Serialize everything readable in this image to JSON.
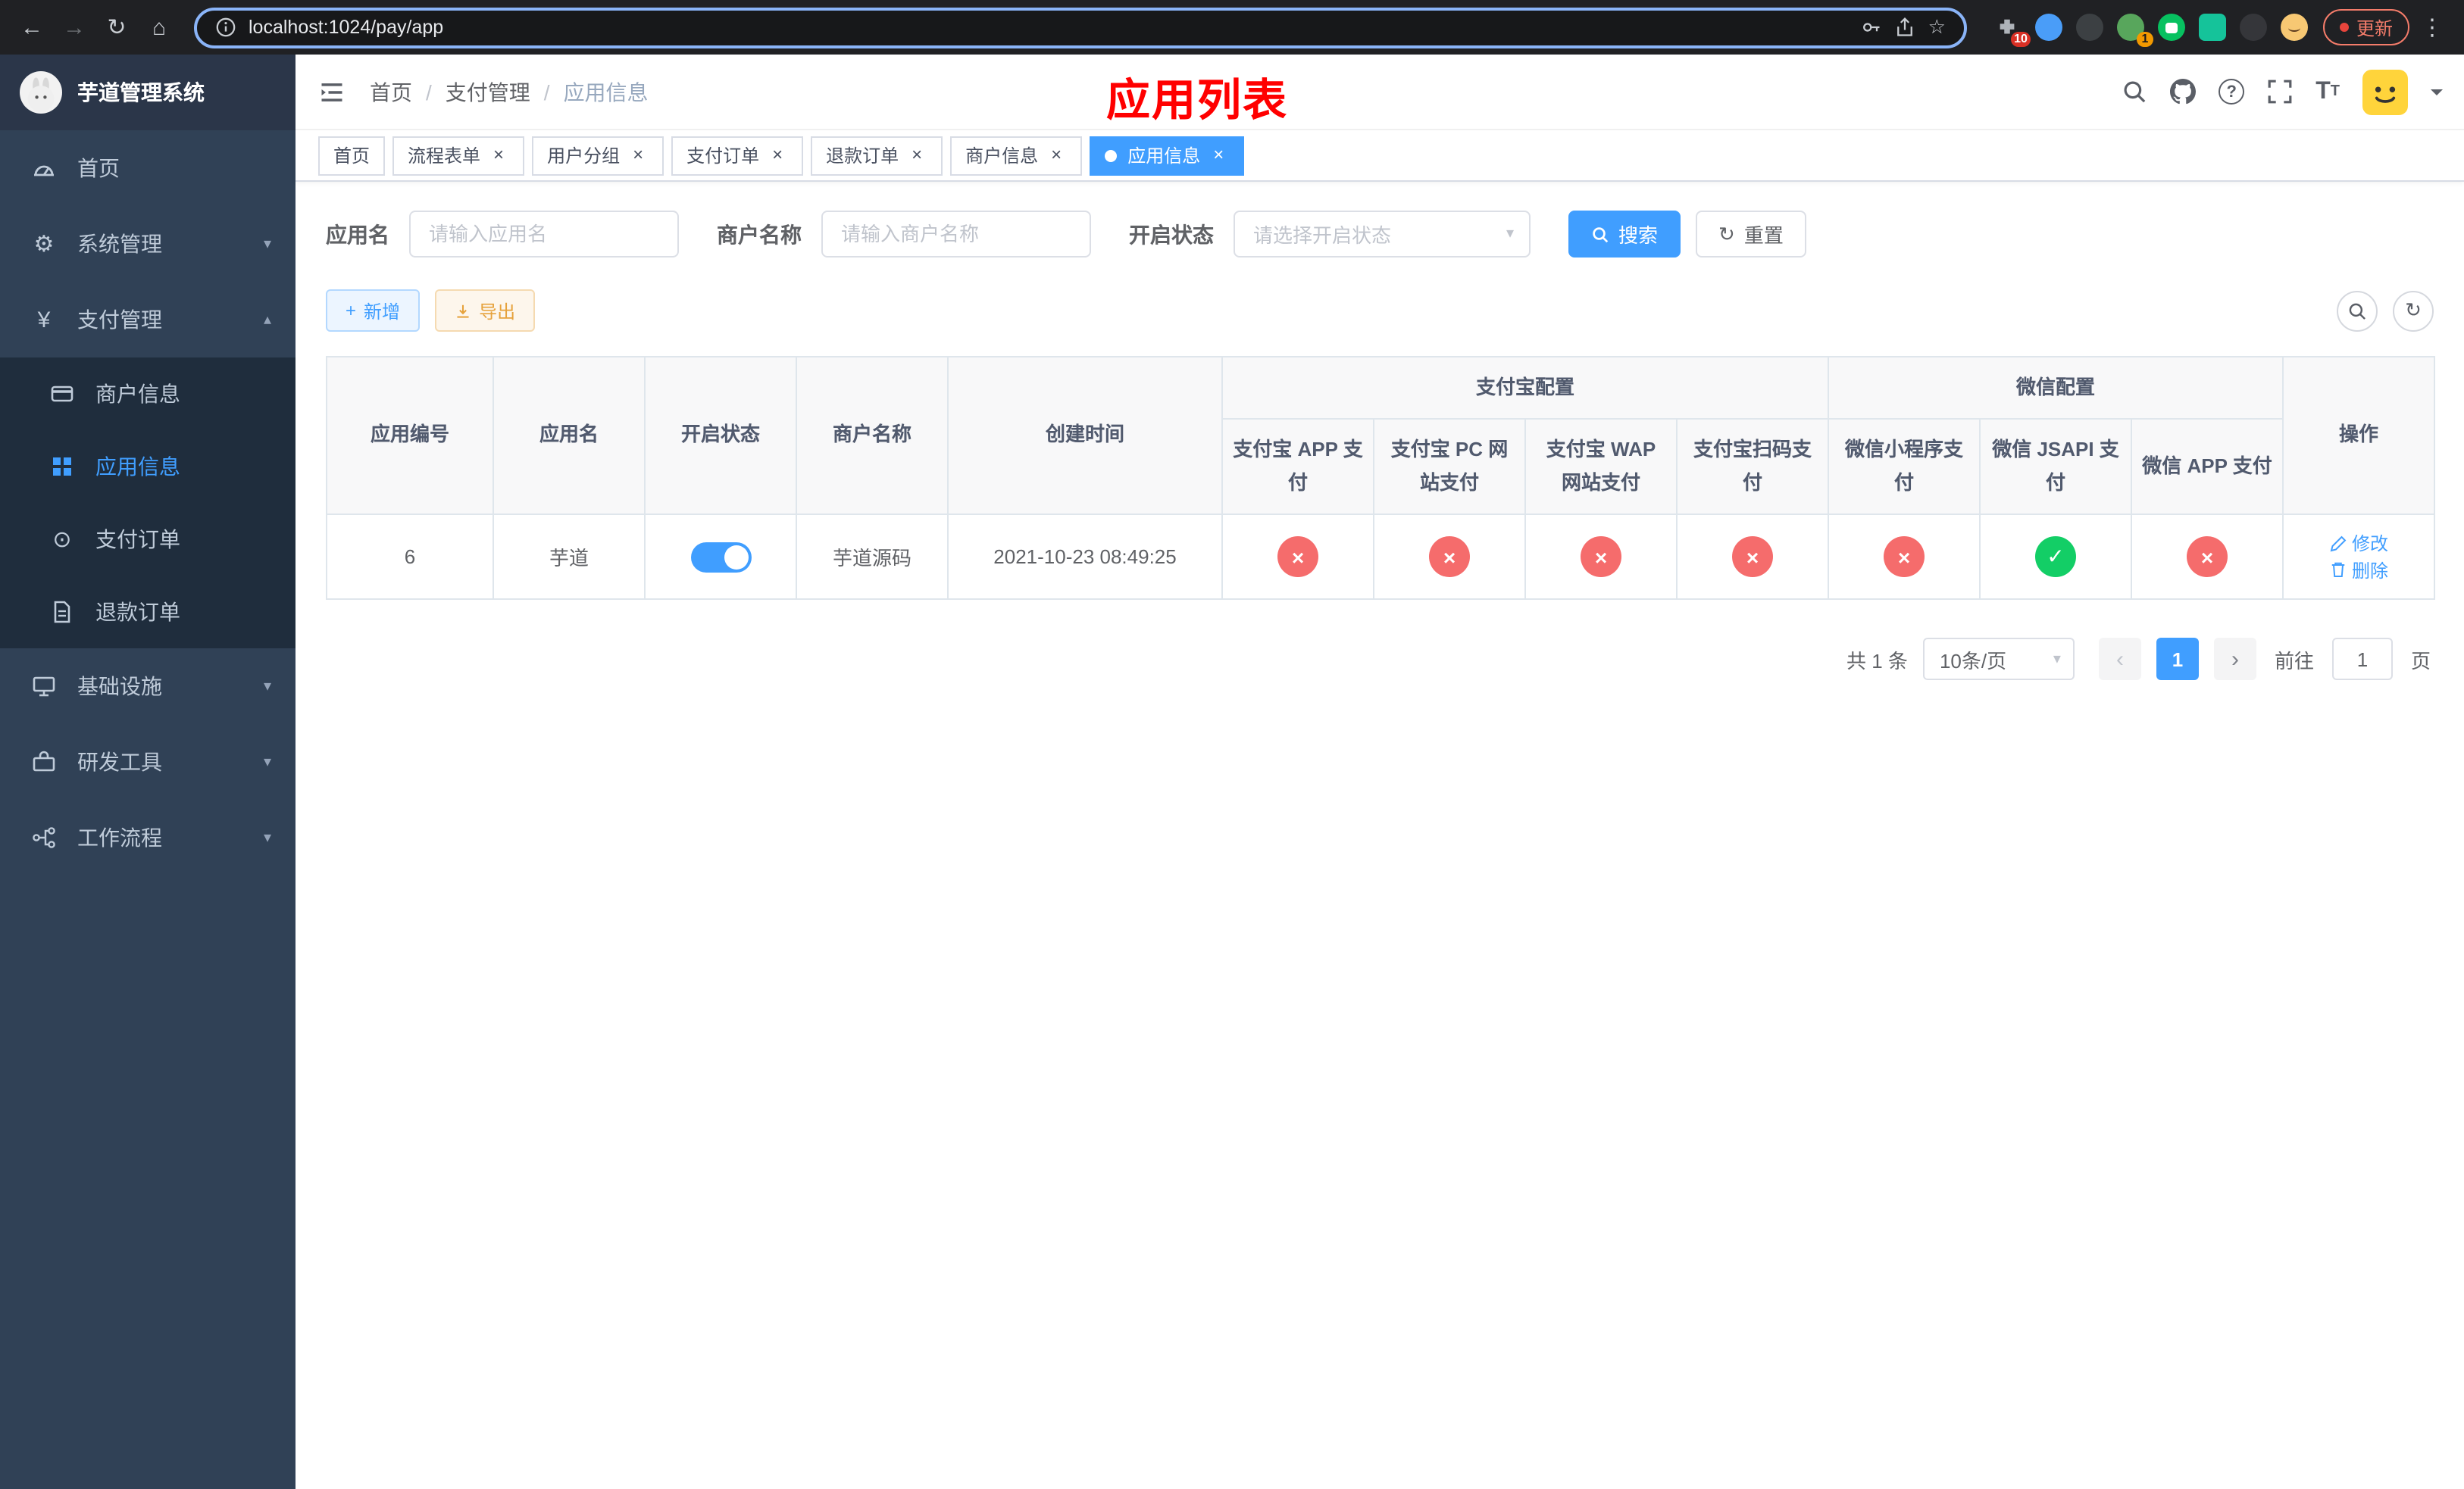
{
  "colors": {
    "accent": "#409EFF",
    "danger": "#f56c6c",
    "success": "#13ce66",
    "title_red": "#ff0000",
    "sidebar_bg": "#304156",
    "submenu_bg": "#1f2d3d"
  },
  "icons": {
    "back": "←",
    "forward": "→",
    "reload": "↻",
    "home": "⌂",
    "star": "☆",
    "dots": "⋮",
    "slash": "/",
    "gear": "⚙",
    "yen": "¥",
    "record": "⊙",
    "caret_down": "▾",
    "caret_up": "▴",
    "plus": "+",
    "close": "×",
    "check": "✓",
    "cross": "×",
    "question": "?",
    "font_t": "T",
    "chevron_left": "‹",
    "chevron_right": "›"
  },
  "browser": {
    "url": "localhost:1024/pay/app",
    "update_label": "更新",
    "extension_badge_1": "10",
    "extension_badge_2": "1"
  },
  "sidebar": {
    "title": "芋道管理系统",
    "items": [
      {
        "label": "首页"
      },
      {
        "label": "系统管理"
      },
      {
        "label": "支付管理"
      },
      {
        "label": "基础设施"
      },
      {
        "label": "研发工具"
      },
      {
        "label": "工作流程"
      }
    ],
    "payment_children": [
      {
        "label": "商户信息"
      },
      {
        "label": "应用信息"
      },
      {
        "label": "支付订单"
      },
      {
        "label": "退款订单"
      }
    ]
  },
  "navbar": {
    "breadcrumb": [
      "首页",
      "支付管理",
      "应用信息"
    ],
    "page_title": "应用列表"
  },
  "tabs": [
    {
      "label": "首页",
      "closable": false,
      "active": false
    },
    {
      "label": "流程表单",
      "closable": true,
      "active": false
    },
    {
      "label": "用户分组",
      "closable": true,
      "active": false
    },
    {
      "label": "支付订单",
      "closable": true,
      "active": false
    },
    {
      "label": "退款订单",
      "closable": true,
      "active": false
    },
    {
      "label": "商户信息",
      "closable": true,
      "active": false
    },
    {
      "label": "应用信息",
      "closable": true,
      "active": true
    }
  ],
  "filters": {
    "app_name": {
      "label": "应用名",
      "placeholder": "请输入应用名"
    },
    "merchant_name": {
      "label": "商户名称",
      "placeholder": "请输入商户名称"
    },
    "status": {
      "label": "开启状态",
      "placeholder": "请选择开启状态"
    },
    "search_label": "搜索",
    "reset_label": "重置"
  },
  "toolbar": {
    "add_label": "新增",
    "export_label": "导出"
  },
  "table": {
    "headers": {
      "app_id": "应用编号",
      "app_name": "应用名",
      "status": "开启状态",
      "merchant_name": "商户名称",
      "created_at": "创建时间",
      "alipay_group": "支付宝配置",
      "wechat_group": "微信配置",
      "actions": "操作"
    },
    "sub_headers": [
      "支付宝 APP 支付",
      "支付宝 PC 网站支付",
      "支付宝 WAP 网站支付",
      "支付宝扫码支付",
      "微信小程序支付",
      "微信 JSAPI 支付",
      "微信 APP 支付"
    ],
    "row": {
      "app_id": "6",
      "app_name": "芋道",
      "status_on": true,
      "merchant_name": "芋道源码",
      "created_at": "2021-10-23 08:49:25",
      "configs": [
        false,
        false,
        false,
        false,
        false,
        true,
        false
      ],
      "edit_label": "修改",
      "delete_label": "删除"
    }
  },
  "pagination": {
    "total_text": "共 1 条",
    "page_size": "10条/页",
    "current_page": "1",
    "goto_prefix": "前往",
    "goto_value": "1",
    "goto_suffix": "页"
  }
}
